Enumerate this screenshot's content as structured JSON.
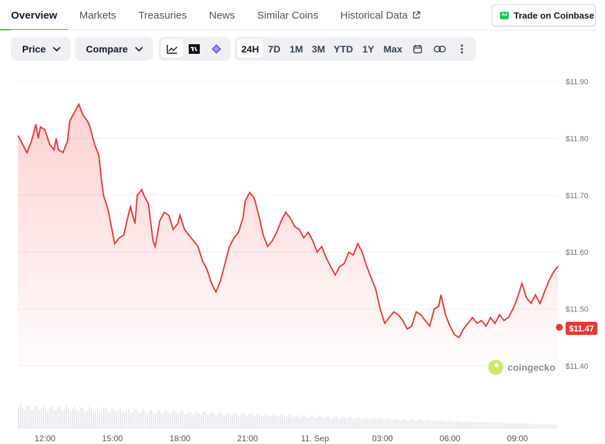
{
  "tabs": [
    {
      "label": "Overview",
      "active": true
    },
    {
      "label": "Markets"
    },
    {
      "label": "Treasuries"
    },
    {
      "label": "News"
    },
    {
      "label": "Similar Coins"
    },
    {
      "label": "Historical Data"
    }
  ],
  "ad": {
    "badge": "Ad",
    "label": "Trade on Coinbase"
  },
  "toolbar": {
    "price_label": "Price",
    "compare_label": "Compare",
    "ranges": [
      "24H",
      "7D",
      "1M",
      "3M",
      "YTD",
      "1Y",
      "Max"
    ],
    "selected_range": "24H"
  },
  "branding": {
    "logo_text": "coingecko"
  },
  "colors": {
    "accent": "#4bcc00",
    "line": "#e53935",
    "tag": "#e53935"
  },
  "chart_data": {
    "type": "area",
    "y_ticks": [
      "$11.90",
      "$11.80",
      "$11.70",
      "$11.60",
      "$11.50",
      "$11.40"
    ],
    "ylim": [
      11.4,
      11.9
    ],
    "x_ticks": [
      "12:00",
      "15:00",
      "18:00",
      "21:00",
      "11. Sep",
      "03:00",
      "06:00",
      "09:00"
    ],
    "x_range_hours": [
      10.8,
      34.8
    ],
    "current_price_label": "$11.47",
    "series": [
      {
        "values": [
          [
            10.8,
            11.805
          ],
          [
            11.0,
            11.79
          ],
          [
            11.2,
            11.775
          ],
          [
            11.4,
            11.795
          ],
          [
            11.5,
            11.81
          ],
          [
            11.6,
            11.825
          ],
          [
            11.7,
            11.8
          ],
          [
            11.8,
            11.82
          ],
          [
            12.0,
            11.815
          ],
          [
            12.2,
            11.79
          ],
          [
            12.4,
            11.78
          ],
          [
            12.5,
            11.8
          ],
          [
            12.6,
            11.78
          ],
          [
            12.8,
            11.775
          ],
          [
            13.0,
            11.795
          ],
          [
            13.1,
            11.83
          ],
          [
            13.3,
            11.845
          ],
          [
            13.5,
            11.86
          ],
          [
            13.7,
            11.84
          ],
          [
            13.9,
            11.83
          ],
          [
            14.0,
            11.82
          ],
          [
            14.2,
            11.79
          ],
          [
            14.4,
            11.77
          ],
          [
            14.5,
            11.73
          ],
          [
            14.6,
            11.7
          ],
          [
            14.8,
            11.675
          ],
          [
            15.0,
            11.635
          ],
          [
            15.1,
            11.615
          ],
          [
            15.3,
            11.625
          ],
          [
            15.5,
            11.63
          ],
          [
            15.7,
            11.665
          ],
          [
            15.8,
            11.68
          ],
          [
            16.0,
            11.65
          ],
          [
            16.1,
            11.7
          ],
          [
            16.3,
            11.71
          ],
          [
            16.4,
            11.7
          ],
          [
            16.6,
            11.685
          ],
          [
            16.8,
            11.62
          ],
          [
            16.9,
            11.61
          ],
          [
            17.1,
            11.655
          ],
          [
            17.3,
            11.67
          ],
          [
            17.5,
            11.665
          ],
          [
            17.7,
            11.64
          ],
          [
            17.9,
            11.65
          ],
          [
            18.0,
            11.665
          ],
          [
            18.2,
            11.64
          ],
          [
            18.4,
            11.63
          ],
          [
            18.6,
            11.62
          ],
          [
            18.8,
            11.61
          ],
          [
            19.0,
            11.585
          ],
          [
            19.2,
            11.57
          ],
          [
            19.4,
            11.545
          ],
          [
            19.6,
            11.53
          ],
          [
            19.8,
            11.55
          ],
          [
            20.0,
            11.58
          ],
          [
            20.2,
            11.61
          ],
          [
            20.4,
            11.625
          ],
          [
            20.6,
            11.635
          ],
          [
            20.8,
            11.66
          ],
          [
            20.9,
            11.69
          ],
          [
            21.1,
            11.705
          ],
          [
            21.3,
            11.695
          ],
          [
            21.5,
            11.665
          ],
          [
            21.7,
            11.63
          ],
          [
            21.9,
            11.61
          ],
          [
            22.1,
            11.62
          ],
          [
            22.3,
            11.635
          ],
          [
            22.5,
            11.655
          ],
          [
            22.7,
            11.67
          ],
          [
            22.9,
            11.66
          ],
          [
            23.1,
            11.645
          ],
          [
            23.3,
            11.64
          ],
          [
            23.5,
            11.625
          ],
          [
            23.7,
            11.635
          ],
          [
            23.9,
            11.62
          ],
          [
            24.1,
            11.6
          ],
          [
            24.3,
            11.61
          ],
          [
            24.5,
            11.59
          ],
          [
            24.7,
            11.575
          ],
          [
            24.9,
            11.56
          ],
          [
            25.1,
            11.575
          ],
          [
            25.3,
            11.58
          ],
          [
            25.5,
            11.6
          ],
          [
            25.7,
            11.595
          ],
          [
            25.9,
            11.615
          ],
          [
            26.1,
            11.6
          ],
          [
            26.3,
            11.575
          ],
          [
            26.5,
            11.555
          ],
          [
            26.7,
            11.535
          ],
          [
            26.9,
            11.5
          ],
          [
            27.1,
            11.475
          ],
          [
            27.3,
            11.485
          ],
          [
            27.5,
            11.495
          ],
          [
            27.7,
            11.49
          ],
          [
            27.9,
            11.48
          ],
          [
            28.1,
            11.465
          ],
          [
            28.3,
            11.47
          ],
          [
            28.5,
            11.495
          ],
          [
            28.7,
            11.49
          ],
          [
            28.9,
            11.48
          ],
          [
            29.1,
            11.47
          ],
          [
            29.3,
            11.5
          ],
          [
            29.5,
            11.505
          ],
          [
            29.6,
            11.525
          ],
          [
            29.8,
            11.49
          ],
          [
            30.0,
            11.47
          ],
          [
            30.2,
            11.455
          ],
          [
            30.4,
            11.45
          ],
          [
            30.6,
            11.465
          ],
          [
            30.8,
            11.475
          ],
          [
            31.0,
            11.485
          ],
          [
            31.2,
            11.475
          ],
          [
            31.4,
            11.48
          ],
          [
            31.6,
            11.47
          ],
          [
            31.8,
            11.485
          ],
          [
            32.0,
            11.475
          ],
          [
            32.2,
            11.49
          ],
          [
            32.4,
            11.48
          ],
          [
            32.6,
            11.485
          ],
          [
            32.8,
            11.5
          ],
          [
            33.0,
            11.52
          ],
          [
            33.2,
            11.545
          ],
          [
            33.4,
            11.52
          ],
          [
            33.6,
            11.51
          ],
          [
            33.8,
            11.525
          ],
          [
            34.0,
            11.51
          ],
          [
            34.2,
            11.53
          ],
          [
            34.4,
            11.55
          ],
          [
            34.6,
            11.565
          ],
          [
            34.7,
            11.57
          ],
          [
            34.8,
            11.575
          ]
        ]
      }
    ],
    "volume_bars": "decreasing"
  }
}
